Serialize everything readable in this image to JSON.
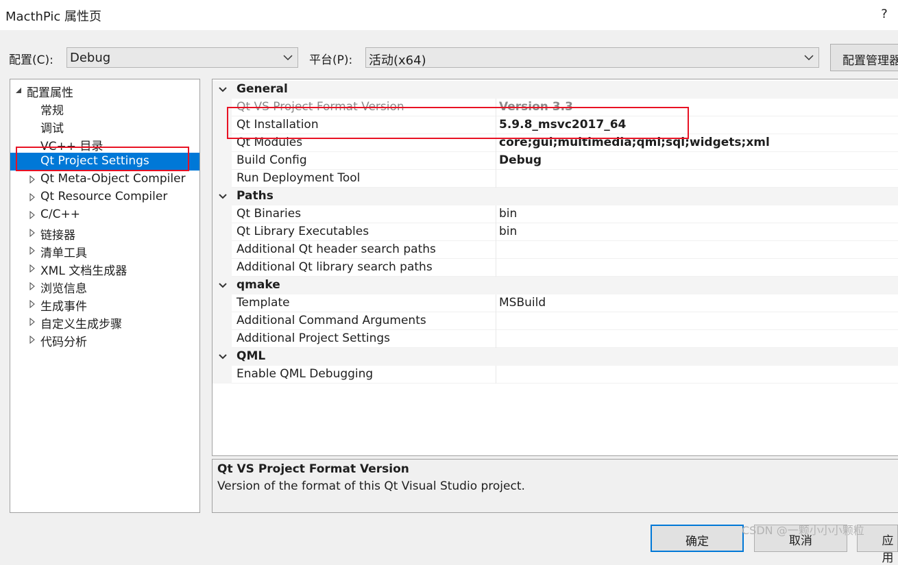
{
  "window": {
    "title": "MacthPic 属性页",
    "help": "?"
  },
  "toolbar": {
    "config_label": "配置(C):",
    "config_value": "Debug",
    "platform_label": "平台(P):",
    "platform_value": "活动(x64)",
    "manager_button": "配置管理器"
  },
  "tree": {
    "items": [
      {
        "label": "配置属性",
        "expander": "expanded"
      },
      {
        "label": "常规"
      },
      {
        "label": "调试"
      },
      {
        "label": "VC++ 目录"
      },
      {
        "label": "Qt Project Settings",
        "selected": true
      },
      {
        "label": "Qt Meta-Object Compiler",
        "expander": "collapsed"
      },
      {
        "label": "Qt Resource Compiler",
        "expander": "collapsed"
      },
      {
        "label": "C/C++",
        "expander": "collapsed"
      },
      {
        "label": "链接器",
        "expander": "collapsed"
      },
      {
        "label": "清单工具",
        "expander": "collapsed"
      },
      {
        "label": "XML 文档生成器",
        "expander": "collapsed"
      },
      {
        "label": "浏览信息",
        "expander": "collapsed"
      },
      {
        "label": "生成事件",
        "expander": "collapsed"
      },
      {
        "label": "自定义生成步骤",
        "expander": "collapsed"
      },
      {
        "label": "代码分析",
        "expander": "collapsed"
      }
    ]
  },
  "grid": {
    "categories": [
      {
        "name": "General",
        "rows": [
          {
            "name": "Qt VS Project Format Version",
            "value": "Version 3.3"
          },
          {
            "name": "Qt Installation",
            "value": "5.9.8_msvc2017_64"
          },
          {
            "name": "Qt Modules",
            "value": "core;gui;multimedia;qml;sql;widgets;xml"
          },
          {
            "name": "Build Config",
            "value": "Debug"
          },
          {
            "name": "Run Deployment Tool",
            "value": ""
          }
        ]
      },
      {
        "name": "Paths",
        "rows": [
          {
            "name": "Qt Binaries",
            "value": "bin"
          },
          {
            "name": "Qt Library Executables",
            "value": "bin"
          },
          {
            "name": "Additional Qt header search paths",
            "value": ""
          },
          {
            "name": "Additional Qt library search paths",
            "value": ""
          }
        ]
      },
      {
        "name": "qmake",
        "rows": [
          {
            "name": "Template",
            "value": "MSBuild"
          },
          {
            "name": "Additional Command Arguments",
            "value": ""
          },
          {
            "name": "Additional Project Settings",
            "value": ""
          }
        ]
      },
      {
        "name": "QML",
        "rows": [
          {
            "name": "Enable QML Debugging",
            "value": ""
          }
        ]
      }
    ]
  },
  "description": {
    "title": "Qt VS Project Format Version",
    "text": "Version of the format of this Qt Visual Studio project."
  },
  "buttons": {
    "ok": "确定",
    "cancel": "取消",
    "apply": "应用"
  },
  "watermark": "CSDN @一颗小小小颗粒",
  "colors": {
    "selection": "#0078d7",
    "highlight_box": "#e81123"
  }
}
